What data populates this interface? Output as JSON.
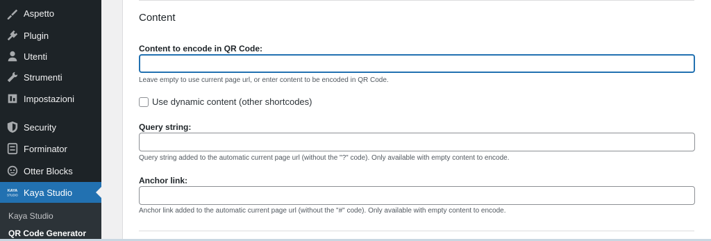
{
  "sidebar": {
    "items": [
      {
        "label": "Aspetto",
        "icon": "paintbrush-icon"
      },
      {
        "label": "Plugin",
        "icon": "plugin-icon"
      },
      {
        "label": "Utenti",
        "icon": "users-icon"
      },
      {
        "label": "Strumenti",
        "icon": "wrench-icon"
      },
      {
        "label": "Impostazioni",
        "icon": "settings-icon"
      },
      {
        "label": "Security",
        "icon": "shield-icon"
      },
      {
        "label": "Forminator",
        "icon": "forminator-icon"
      },
      {
        "label": "Otter Blocks",
        "icon": "otter-icon"
      },
      {
        "label": "Kaya Studio",
        "icon": "kaya-logo-icon",
        "logo_text": "KAYA STUDIO"
      }
    ],
    "submenu": [
      {
        "label": "Kaya Studio"
      },
      {
        "label": "QR Code Generator"
      }
    ],
    "active_color": "#2271b1"
  },
  "content": {
    "section_title": "Content",
    "qr_content": {
      "label": "Content to encode in QR Code:",
      "value": "",
      "help": "Leave empty to use current page url, or enter content to be encoded in QR Code."
    },
    "dynamic_content": {
      "label": "Use dynamic content (other shortcodes)",
      "checked": false
    },
    "query_string": {
      "label": "Query string:",
      "value": "",
      "help": "Query string added to the automatic current page url (without the \"?\" code). Only available with empty content to encode."
    },
    "anchor_link": {
      "label": "Anchor link:",
      "value": "",
      "help": "Anchor link added to the automatic current page url (without the \"#\" code). Only available with empty content to encode."
    }
  }
}
